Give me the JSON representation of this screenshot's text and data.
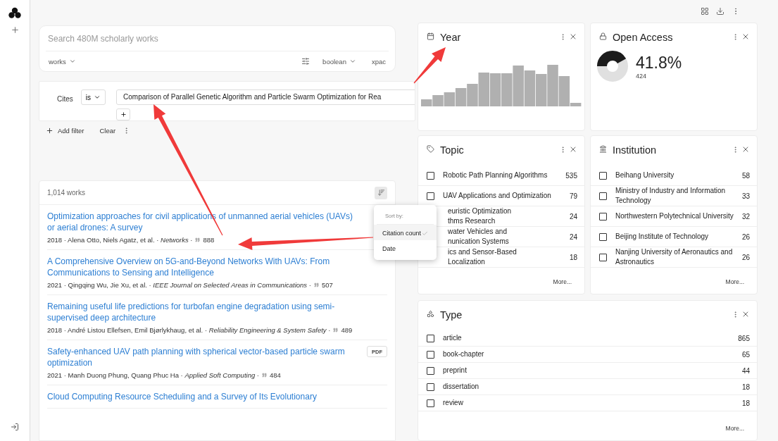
{
  "search": {
    "placeholder": "Search 480M scholarly works",
    "entity": "works",
    "mode": "boolean",
    "extra": "xpac"
  },
  "filter": {
    "label": "Cites",
    "operator": "is",
    "value": "Comparison of Parallel Genetic Algorithm and Particle Swarm Optimization for Rea"
  },
  "filter_actions": [
    "Add filter",
    "Clear"
  ],
  "results": {
    "count": "1,014 works",
    "items": [
      {
        "title": "Optimization approaches for civil applications of unmanned aerial vehicles (UAVs) or aerial drones: A survey",
        "meta": "2018 · Alena Otto, Niels Agatz, et al. · *Networks* ·",
        "citations": "888",
        "pdf": false
      },
      {
        "title": "A Comprehensive Overview on 5G-and-Beyond Networks With UAVs: From Communications to Sensing and Intelligence",
        "meta": "2021 · Qingqing Wu, Jie Xu, et al. · *IEEE Journal on Selected Areas in Communications* ·",
        "citations": "507",
        "pdf": false
      },
      {
        "title": "Remaining useful life predictions for turbofan engine degradation using semi-supervised deep architecture",
        "meta": "2018 · André Listou Ellefsen, Emil Bjørlykhaug, et al. · *Reliability Engineering & System Safety* ·",
        "citations": "489",
        "pdf": false
      },
      {
        "title": "Safety-enhanced UAV path planning with spherical vector-based particle swarm optimization",
        "meta": "2021 · Manh Duong Phung, Quang Phuc Ha · *Applied Soft Computing* ·",
        "citations": "484",
        "pdf": true,
        "pdf_label": "PDF"
      },
      {
        "title": "Cloud Computing Resource Scheduling and a Survey of Its Evolutionary",
        "pdf": false
      }
    ]
  },
  "sort_menu": {
    "heading": "Sort by:",
    "options": [
      {
        "label": "Citation count",
        "selected": true
      },
      {
        "label": "Date",
        "selected": false
      }
    ]
  },
  "year_card": {
    "title": "Year"
  },
  "open_access": {
    "title": "Open Access",
    "percent": "41.8%",
    "count": "424",
    "level": 0.418
  },
  "topic": {
    "title": "Topic",
    "more": "More...",
    "items": [
      {
        "kind": "full",
        "label": "Robotic Path Planning Algorithms",
        "count": "535",
        "checked": false
      },
      {
        "kind": "full",
        "label": "UAV Applications and Optimization",
        "count": "79",
        "checked": false
      },
      {
        "kind": "covered",
        "lines": [
          "euristic Optimization",
          "thms Research"
        ],
        "count": "24"
      },
      {
        "kind": "covered",
        "lines": [
          "water Vehicles and",
          "nunication Systems"
        ],
        "count": "24"
      },
      {
        "kind": "covered",
        "lines": [
          "ics and Sensor-Based",
          "Localization"
        ],
        "count": "18"
      }
    ]
  },
  "institution": {
    "title": "Institution",
    "more": "More...",
    "items": [
      {
        "kind": "full",
        "label": "Beihang University",
        "count": "58",
        "checked": false
      },
      {
        "kind": "full",
        "label": "Ministry of Industry and Information Technology",
        "count": "33",
        "checked": false
      },
      {
        "kind": "full",
        "label": "Northwestern Polytechnical University",
        "count": "32",
        "checked": false
      },
      {
        "kind": "full",
        "label": "Beijing Institute of Technology",
        "count": "26",
        "checked": false
      },
      {
        "kind": "full",
        "label": "Nanjing University of Aeronautics and Astronautics",
        "count": "26",
        "checked": false
      }
    ]
  },
  "type": {
    "title": "Type",
    "more": "More...",
    "items": [
      {
        "kind": "full",
        "label": "article",
        "count": "865",
        "checked": false
      },
      {
        "kind": "full",
        "label": "book-chapter",
        "count": "65",
        "checked": false
      },
      {
        "kind": "full",
        "label": "preprint",
        "count": "44",
        "checked": false
      },
      {
        "kind": "full",
        "label": "dissertation",
        "count": "18",
        "checked": false
      },
      {
        "kind": "full",
        "label": "review",
        "count": "18",
        "checked": false
      }
    ]
  }
}
